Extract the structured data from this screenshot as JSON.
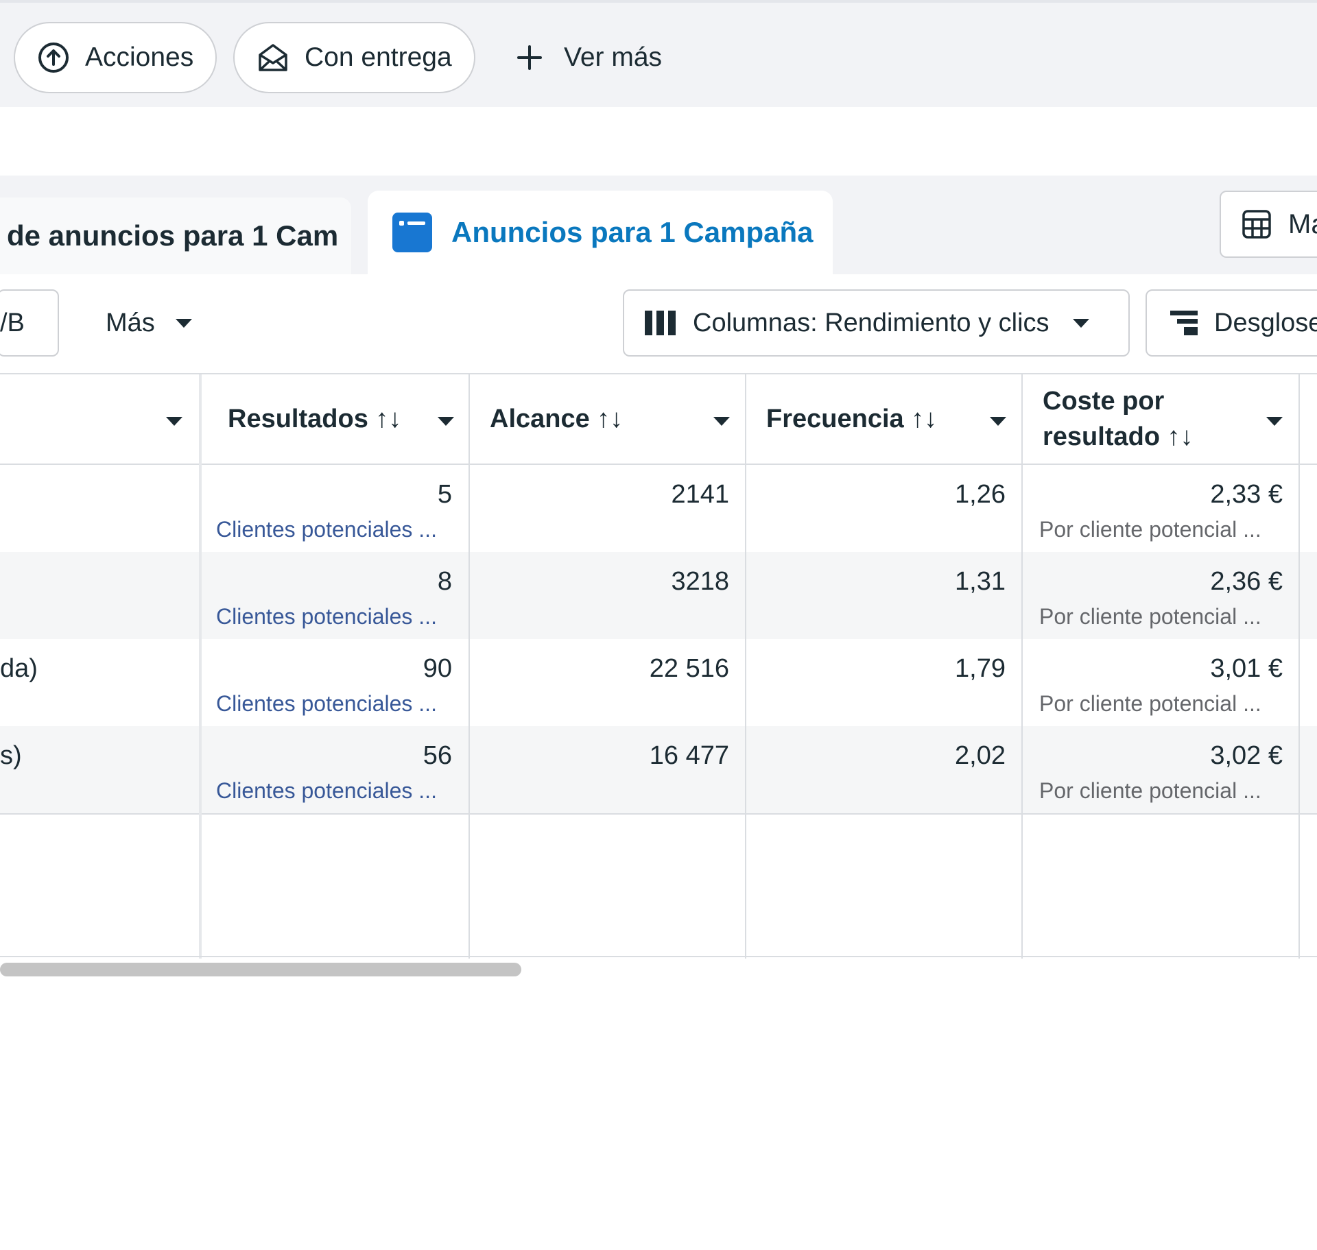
{
  "topbar": {
    "actions_label": "Acciones",
    "delivery_label": "Con entrega",
    "more_label": "Ver más"
  },
  "tabs": {
    "inactive_label": "de anuncios para 1 Cam",
    "active_label": "Anuncios para 1 Campaña",
    "right_button_label": "Ma"
  },
  "toolbar": {
    "ab_label": "/B",
    "more_label": "Más",
    "columns_label": "Columnas: Rendimiento y clics",
    "breakdown_label": "Desglose"
  },
  "table": {
    "headers": {
      "results": "Resultados ↑↓",
      "reach": "Alcance ↑↓",
      "frequency": "Frecuencia ↑↓",
      "cost_line1": "Coste por",
      "cost_line2": "resultado ↑↓"
    },
    "rows": [
      {
        "name": "",
        "results": "5",
        "results_sub": "Clientes potenciales ...",
        "reach": "2141",
        "frequency": "1,26",
        "cost": "2,33 €",
        "cost_sub": "Por cliente potencial ..."
      },
      {
        "name": "",
        "results": "8",
        "results_sub": "Clientes potenciales ...",
        "reach": "3218",
        "frequency": "1,31",
        "cost": "2,36 €",
        "cost_sub": "Por cliente potencial ..."
      },
      {
        "name": "da)",
        "results": "90",
        "results_sub": "Clientes potenciales ...",
        "reach": "22 516",
        "frequency": "1,79",
        "cost": "3,01 €",
        "cost_sub": "Por cliente potencial ..."
      },
      {
        "name": "s)",
        "results": "56",
        "results_sub": "Clientes potenciales ...",
        "reach": "16 477",
        "frequency": "2,02",
        "cost": "3,02 €",
        "cost_sub": "Por cliente potencial ..."
      }
    ]
  }
}
